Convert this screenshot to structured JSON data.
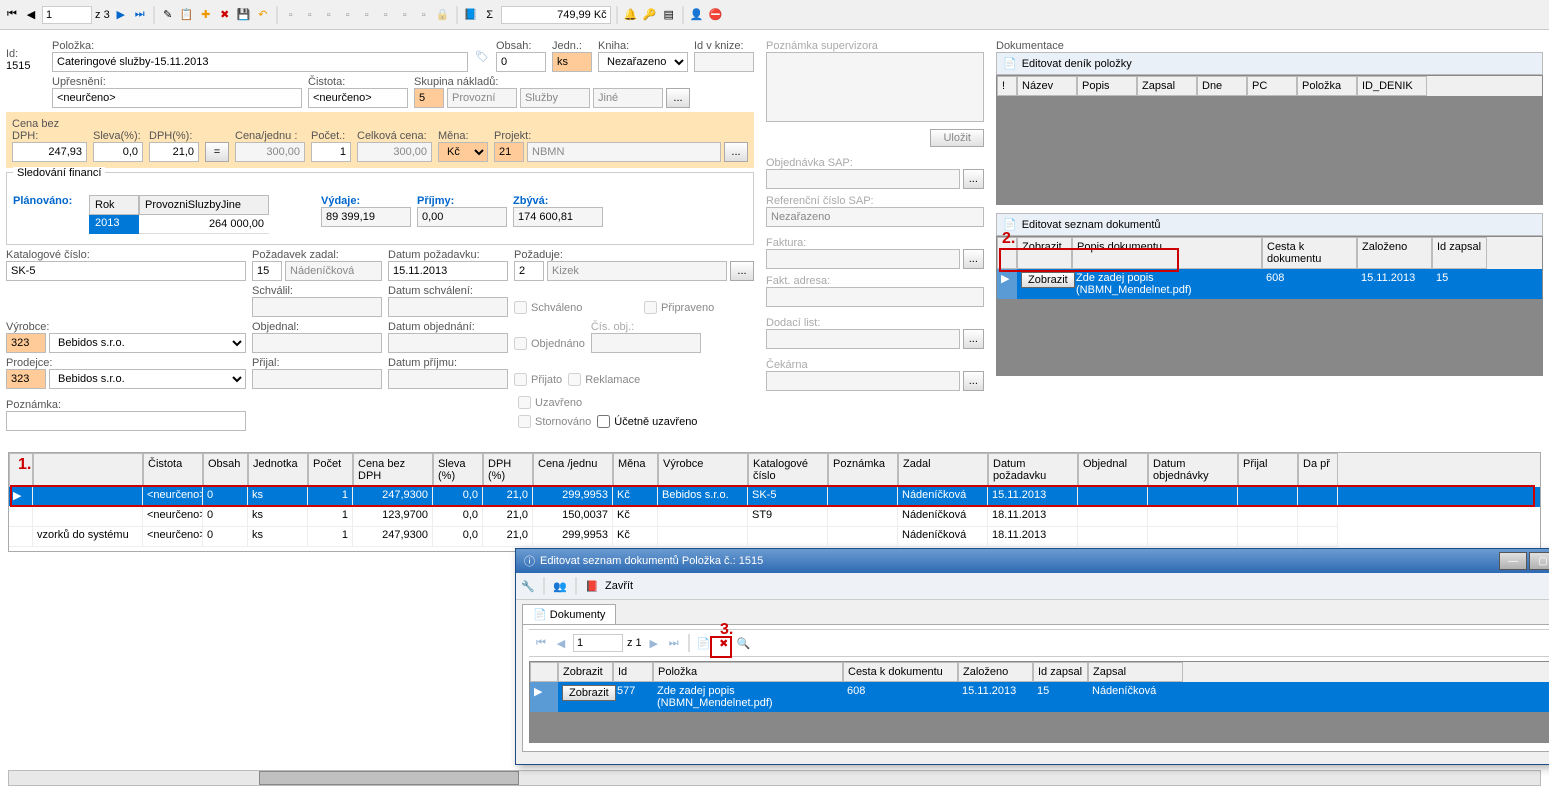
{
  "toolbar": {
    "page_current": "1",
    "page_total_prefix": "z ",
    "page_total": "3",
    "amount": "749,99 Kč"
  },
  "form": {
    "id_label": "Id:",
    "id_value": "1515",
    "polozka_label": "Položka:",
    "polozka_value": "Cateringové služby-15.11.2013",
    "obsah_label": "Obsah:",
    "obsah_value": "0",
    "jedn_label": "Jedn.:",
    "jedn_value": "ks",
    "kniha_label": "Kniha:",
    "kniha_value": "Nezařazeno",
    "idvknize_label": "Id v knize:",
    "idvknize_value": "",
    "upresneni_label": "Upřesnění:",
    "upresneni_value": "<neurčeno>",
    "cistota_label": "Čistota:",
    "cistota_value": "<neurčeno>",
    "skupina_label": "Skupina nákladů:",
    "skupina_code": "5",
    "skupina_a": "Provozní",
    "skupina_b": "Služby",
    "skupina_c": "Jiné"
  },
  "calc": {
    "cena_bez_label": "Cena bez DPH:",
    "cena_bez": "247,93",
    "sleva_label": "Sleva(%):",
    "sleva": "0,0",
    "dph_label": "DPH(%):",
    "dph": "21,0",
    "cena_jednu_label": "Cena/jednu :",
    "cena_jednu": "300,00",
    "pocet_label": "Počet.:",
    "pocet": "1",
    "celkova_label": "Celková cena:",
    "celkova": "300,00",
    "mena_label": "Měna:",
    "mena": "Kč",
    "projekt_label": "Projekt:",
    "projekt_code": "21",
    "projekt_name": "NBMN"
  },
  "fin": {
    "title": "Sledování financí",
    "planovano": "Plánováno:",
    "rok_h": "Rok",
    "zdroj_h": "ProvozniSluzbyJine",
    "rok": "2013",
    "castka": "264 000,00",
    "vydaje_label": "Výdaje:",
    "vydaje": "89 399,19",
    "prijmy_label": "Příjmy:",
    "prijmy": "0,00",
    "zbyva_label": "Zbývá:",
    "zbyva": "174 600,81"
  },
  "req": {
    "katalog_label": "Katalogové číslo:",
    "katalog": "SK-5",
    "pozadavek_zadal_label": "Požadavek zadal:",
    "pozadavek_zadal_id": "15",
    "pozadavek_zadal_name": "Nádeníčková",
    "schvalil_label": "Schválil:",
    "datum_pozadavku_label": "Datum požadavku:",
    "datum_pozadavku": "15.11.2013",
    "datum_schvaleni_label": "Datum schválení:",
    "pozaduje_label": "Požaduje:",
    "pozaduje_id": "2",
    "pozaduje_name": "Kizek",
    "vyrobce_label": "Výrobce:",
    "vyrobce_id": "323",
    "vyrobce_name": "Bebidos s.r.o.",
    "prodejce_label": "Prodejce:",
    "prodejce_id": "323",
    "prodejce_name": "Bebidos s.r.o.",
    "objednal_label": "Objednal:",
    "prijal_label": "Přijal:",
    "datum_objednani_label": "Datum objednání:",
    "datum_prijmu_label": "Datum příjmu:",
    "cis_obj_label": "Čís. obj.:",
    "poznamka_label": "Poznámka:"
  },
  "checks": {
    "schvaleno": "Schváleno",
    "objednano": "Objednáno",
    "prijato": "Přijato",
    "uzavreno": "Uzavřeno",
    "stornoano": "Stornováno",
    "pripraveno": "Připraveno",
    "reklamace": "Reklamace",
    "ucetne": "Účetně uzavřeno"
  },
  "side": {
    "supervisor_label": "Poznámka supervizora",
    "ulozit": "Uložit",
    "sap_label": "Objednávka SAP:",
    "ref_sap_label": "Referenční číslo SAP:",
    "ref_sap_value": "Nezařazeno",
    "faktura_label": "Faktura:",
    "fakt_adresa_label": "Fakt. adresa:",
    "dodaci_label": "Dodací list:",
    "cekarna_label": "Čekárna"
  },
  "docs": {
    "section": "Dokumentace",
    "edit_denik": "Editovat deník položky",
    "denik_cols": [
      "!",
      "Název",
      "Popis",
      "Zapsal",
      "Dne",
      "PC",
      "Položka",
      "ID_DENIK"
    ],
    "edit_seznam": "Editovat seznam dokumentů",
    "cols": {
      "zobrazit": "Zobrazit",
      "popis": "Popis dokumentu",
      "cesta": "Cesta k dokumentu",
      "zalozeno": "Založeno",
      "idzapsal": "Id zapsal"
    },
    "row": {
      "zobrazit": "Zobrazit",
      "popis": "Zde zadej popis (NBMN_Mendelnet.pdf)",
      "cesta": "608",
      "zalozeno": "15.11.2013",
      "idzapsal": "15"
    }
  },
  "list": {
    "cols": [
      "",
      "",
      "Čistota",
      "Obsah",
      "Jednotka",
      "Počet",
      "Cena bez DPH",
      "Sleva (%)",
      "DPH (%)",
      "Cena /jednu",
      "Měna",
      "Výrobce",
      "Katalogové číslo",
      "Poznámka",
      "Zadal",
      "Datum požadavku",
      "Objednal",
      "Datum objednávky",
      "Přijal",
      "Da př"
    ],
    "rows": [
      {
        "sel": true,
        "cells": [
          "▶",
          "",
          "<neurčeno>",
          "0",
          "ks",
          "1",
          "247,9300",
          "0,0",
          "21,0",
          "299,9953",
          "Kč",
          "Bebidos s.r.o.",
          "SK-5",
          "",
          "Nádeníčková",
          "15.11.2013",
          "",
          "",
          "",
          ""
        ]
      },
      {
        "sel": false,
        "cells": [
          "",
          "",
          "<neurčeno>",
          "0",
          "ks",
          "1",
          "123,9700",
          "0,0",
          "21,0",
          "150,0037",
          "Kč",
          "",
          "ST9",
          "",
          "Nádeníčková",
          "18.11.2013",
          "",
          "",
          "",
          ""
        ]
      },
      {
        "sel": false,
        "cells": [
          "",
          "vzorků do systému",
          "<neurčeno>",
          "0",
          "ks",
          "1",
          "247,9300",
          "0,0",
          "21,0",
          "299,9953",
          "Kč",
          "",
          "",
          "",
          "Nádeníčková",
          "18.11.2013",
          "",
          "",
          "",
          ""
        ]
      }
    ]
  },
  "annot": {
    "one": "1.",
    "two": "2.",
    "three": "3."
  },
  "dialog": {
    "title": "Editovat seznam dokumentů Položka č.: 1515",
    "zavrit": "Zavřít",
    "tab": "Dokumenty",
    "page": "1",
    "total": "z 1",
    "cols": {
      "zobrazit": "Zobrazit",
      "id": "Id",
      "polozka": "Položka",
      "cesta": "Cesta k dokumentu",
      "zalozeno": "Založeno",
      "idzapsal": "Id zapsal",
      "zapsal": "Zapsal"
    },
    "row": {
      "zobrazit": "Zobrazit",
      "id": "577",
      "polozka": "Zde zadej popis (NBMN_Mendelnet.pdf)",
      "cesta": "608",
      "zalozeno": "15.11.2013",
      "idzapsal": "15",
      "zapsal": "Nádeníčková"
    }
  }
}
